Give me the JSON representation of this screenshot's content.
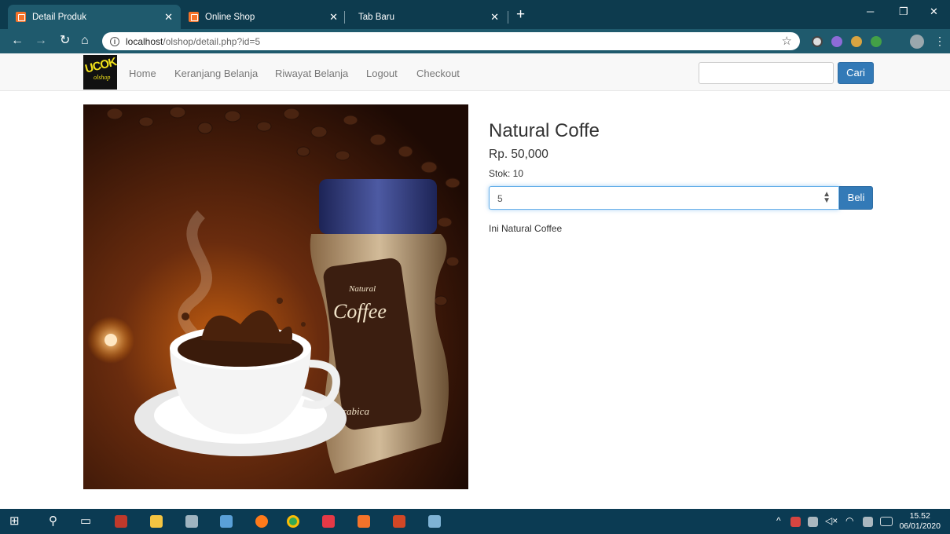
{
  "browser": {
    "tabs": [
      {
        "title": "Detail Produk",
        "active": true
      },
      {
        "title": "Online Shop",
        "active": false
      },
      {
        "title": "Tab Baru",
        "active": false
      }
    ],
    "url_host": "localhost",
    "url_path": "/olshop/detail.php?id=5"
  },
  "site": {
    "logo_main": "UCOK",
    "logo_sub": "olshop",
    "nav": [
      "Home",
      "Keranjang Belanja",
      "Riwayat Belanja",
      "Logout",
      "Checkout"
    ],
    "search_value": "",
    "search_button": "Cari"
  },
  "product": {
    "name": "Natural Coffe",
    "price": "Rp. 50,000",
    "stock": "Stok: 10",
    "qty_value": "5",
    "buy_button": "Beli",
    "description": "Ini Natural Coffee",
    "image_label_top": "Natural",
    "image_label_main": "Coffee",
    "image_label_bottom": "rabica"
  },
  "taskbar": {
    "time": "15.52",
    "date": "06/01/2020"
  },
  "colors": {
    "primary": "#337ab7",
    "chrome": "#0d3b4e",
    "taskbar": "#0b3b53"
  }
}
